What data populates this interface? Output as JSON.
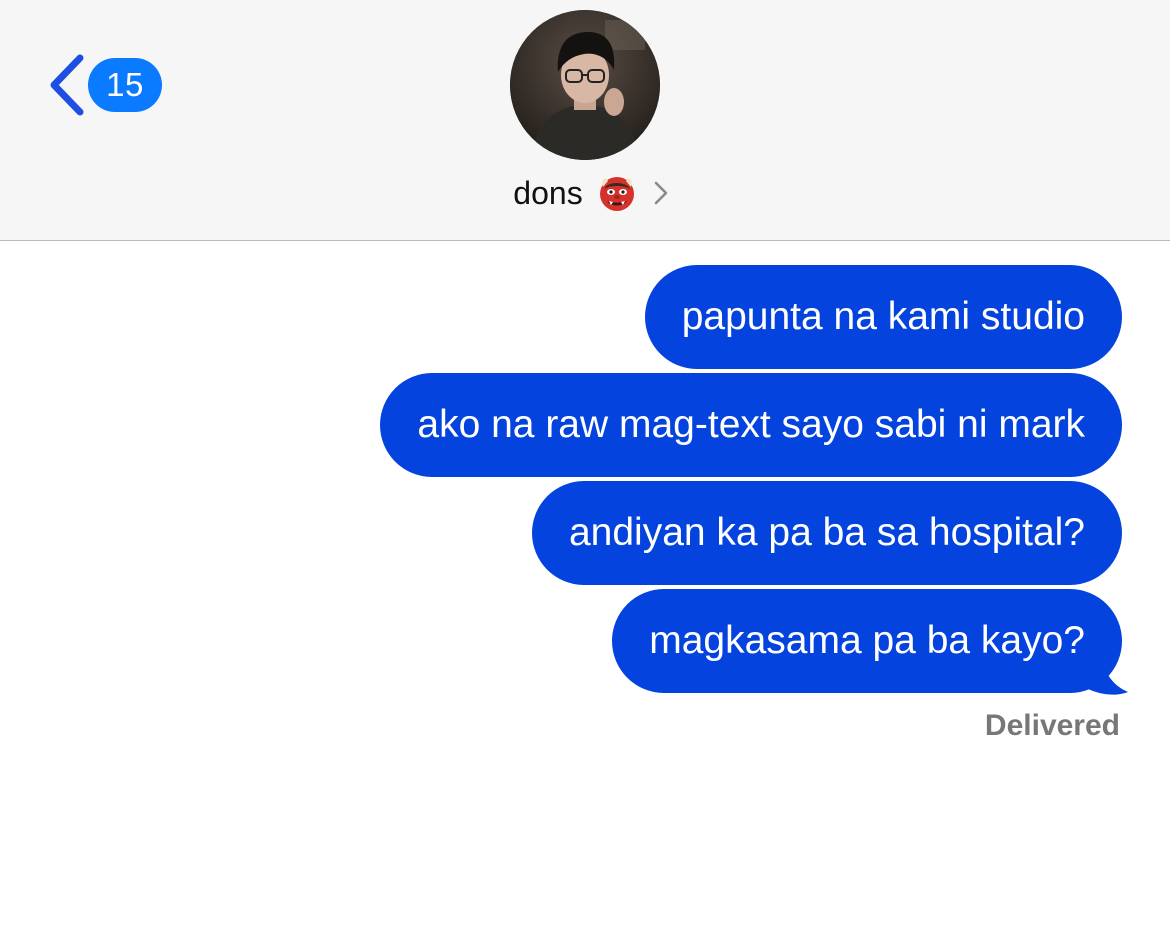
{
  "header": {
    "back_count": "15",
    "contact_name": "dons",
    "contact_emoji_icon": "ogre-icon"
  },
  "colors": {
    "accent_blue": "#0a7aff",
    "bubble_blue": "#0443de",
    "header_bg": "#f6f6f6",
    "status_gray": "#777779"
  },
  "messages": [
    {
      "text": "papunta na kami studio",
      "sender": "me"
    },
    {
      "text": "ako na raw mag-text sayo sabi ni mark",
      "sender": "me"
    },
    {
      "text": "andiyan ka pa ba sa hospital?",
      "sender": "me"
    },
    {
      "text": "magkasama pa ba kayo?",
      "sender": "me"
    }
  ],
  "status": {
    "delivered_label": "Delivered"
  }
}
